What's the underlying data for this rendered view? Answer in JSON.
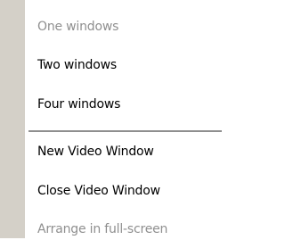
{
  "menu": {
    "items": [
      {
        "label": "One windows",
        "enabled": false
      },
      {
        "label": "Two windows",
        "enabled": true
      },
      {
        "label": "Four windows",
        "enabled": true
      },
      {
        "label": "New Video Window",
        "enabled": true
      },
      {
        "label": "Close Video Window",
        "enabled": true
      },
      {
        "label": "Arrange in full-screen",
        "enabled": false
      }
    ]
  }
}
